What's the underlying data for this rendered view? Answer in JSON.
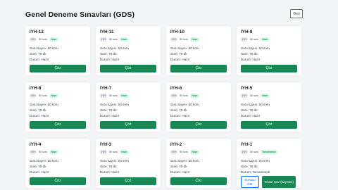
{
  "page": {
    "title": "Genel Deneme Sınavları (GDS)",
    "back_label": "Geri"
  },
  "labels": {
    "count_prefix": "Soru sayısı: ",
    "duration_prefix": "Süre: ",
    "status_prefix": "Durum: ",
    "solve_button": "Çöz",
    "view_result_button": "Sonucu Gör",
    "repeat_button": "Tekrar Çöz (kayıtsız)"
  },
  "exams": [
    {
      "title": "IYH-12",
      "code": "IYH",
      "count_badge": "50 soru",
      "status": "Hazır",
      "questions": "50 soru",
      "duration": "75 dk"
    },
    {
      "title": "IYH-11",
      "code": "IYH",
      "count_badge": "50 soru",
      "status": "Hazır",
      "questions": "50 soru",
      "duration": "75 dk"
    },
    {
      "title": "IYH-10",
      "code": "IYH",
      "count_badge": "50 soru",
      "status": "Hazır",
      "questions": "50 soru",
      "duration": "75 dk"
    },
    {
      "title": "IYH-9",
      "code": "IYH",
      "count_badge": "50 soru",
      "status": "Hazır",
      "questions": "50 soru",
      "duration": "75 dk"
    },
    {
      "title": "IYH-8",
      "code": "IYH",
      "count_badge": "50 soru",
      "status": "Hazır",
      "questions": "50 soru",
      "duration": "75 dk"
    },
    {
      "title": "IYH-7",
      "code": "IYH",
      "count_badge": "50 soru",
      "status": "Hazır",
      "questions": "50 soru",
      "duration": "75 dk"
    },
    {
      "title": "IYH-6",
      "code": "IYH",
      "count_badge": "50 soru",
      "status": "Hazır",
      "questions": "50 soru",
      "duration": "75 dk"
    },
    {
      "title": "IYH-5",
      "code": "IYH",
      "count_badge": "50 soru",
      "status": "Hazır",
      "questions": "50 soru",
      "duration": "75 dk"
    },
    {
      "title": "IYH-4",
      "code": "IYH",
      "count_badge": "50 soru",
      "status": "Hazır",
      "questions": "50 soru",
      "duration": "75 dk"
    },
    {
      "title": "IYH-3",
      "code": "IYH",
      "count_badge": "50 soru",
      "status": "Hazır",
      "questions": "50 soru",
      "duration": "75 dk"
    },
    {
      "title": "IYH-2",
      "code": "IYH",
      "count_badge": "50 soru",
      "status": "Hazır",
      "questions": "50 soru",
      "duration": "75 dk"
    },
    {
      "title": "IYH-1",
      "code": "IYH",
      "count_badge": "50 soru",
      "status": "Tamamlandı",
      "questions": "50 soru",
      "duration": "75 dk",
      "completed": true
    }
  ],
  "colors": {
    "accent_green": "#198754",
    "badge_green_bg": "#d1fae5",
    "outline_blue": "#0d6efd"
  }
}
